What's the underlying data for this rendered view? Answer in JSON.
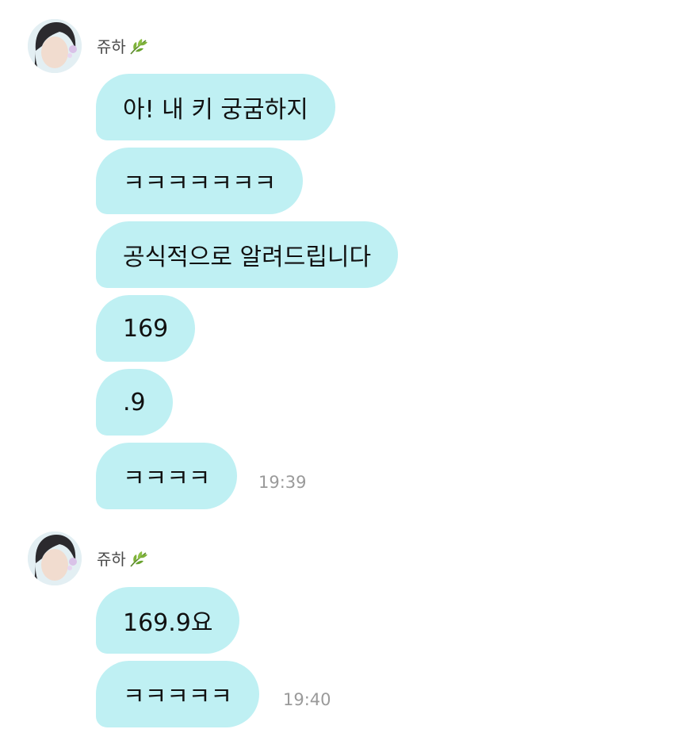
{
  "colors": {
    "bubble": "#bff0f3",
    "page_background": "#ffffff",
    "timestamp": "#9a9a9a"
  },
  "groups": [
    {
      "sender_name": "쥬하",
      "sender_icon": "leaf-icon",
      "messages": [
        {
          "text": "아! 내 키 궁굼하지"
        },
        {
          "text": "ㅋㅋㅋㅋㅋㅋㅋ"
        },
        {
          "text": "공식적으로 알려드립니다"
        },
        {
          "text": "169"
        },
        {
          "text": ".9"
        },
        {
          "text": "ㅋㅋㅋㅋ"
        }
      ],
      "timestamp": "19:39"
    },
    {
      "sender_name": "쥬하",
      "sender_icon": "leaf-icon",
      "messages": [
        {
          "text": "169.9요"
        },
        {
          "text": "ㅋㅋㅋㅋㅋ"
        }
      ],
      "timestamp": "19:40"
    }
  ]
}
